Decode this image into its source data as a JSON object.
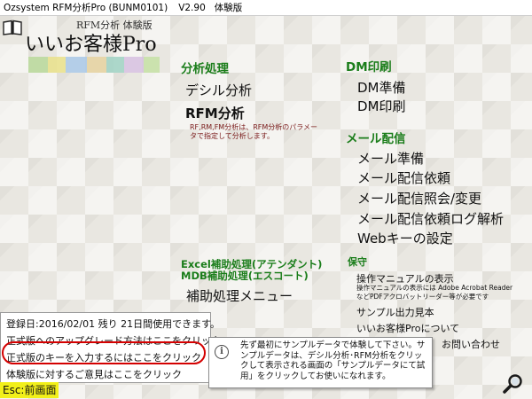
{
  "window": {
    "title": "Ozsystem RFM分析Pro (BUNM0101)",
    "version": "V2.90",
    "edition": "体験版"
  },
  "logo": {
    "subtitle": "RFM分析 体験版",
    "title": "いいお客様Pro"
  },
  "analysis": {
    "heading": "分析処理",
    "decile": "デシル分析",
    "rfm": "RFM分析",
    "rfm_note": "RF,RM,FM分析は、RFM分析のパラメータで指定して分析します。"
  },
  "dm": {
    "heading": "DM印刷",
    "prep": "DM準備",
    "print": "DM印刷"
  },
  "mail": {
    "heading": "メール配信",
    "prep": "メール準備",
    "request": "メール配信依頼",
    "inquiry": "メール配信照会/変更",
    "log": "メール配信依頼ログ解析",
    "webkey": "Webキーの設定"
  },
  "excel": {
    "heading1": "Excel補助処理(アテンダント)",
    "heading2": "MDB補助処理(エスコート)",
    "menu": "補助処理メニュー"
  },
  "maintenance": {
    "heading": "保守",
    "manual": "操作マニュアルの表示",
    "manual_note": "操作マニュアルの表示には Adobe Acrobat ReaderなどPDFアクロバットリーダー等が必要です",
    "sample": "サンプル出力見本",
    "about": "いいお客様Proについて",
    "contact": "お問い合わせ"
  },
  "info": {
    "reg_date": "登録日:2016/02/01  残り 21日間使用できます。",
    "upgrade": "正式版へのアップグレード方法はここをクリック",
    "enter_key": "正式版のキーを入力するにはここをクリック",
    "feedback": "体験版に対するご意見はここをクリック"
  },
  "esc": "Esc:前画面",
  "tooltip": {
    "text": "先ず最初にサンプルデータで体験して下さい。サンプルデータは、デシル分析･RFM分析をクリックして表示される画面の「サンプルデータにて試用」をクリックしてお使いになれます。"
  },
  "colors": {
    "heading": "#1a7d1a",
    "note": "#7a1b1b",
    "highlight_oval": "#d40000",
    "esc_bg": "#f2f01a"
  },
  "icons": [
    "book-icon",
    "info-icon",
    "search-icon"
  ]
}
